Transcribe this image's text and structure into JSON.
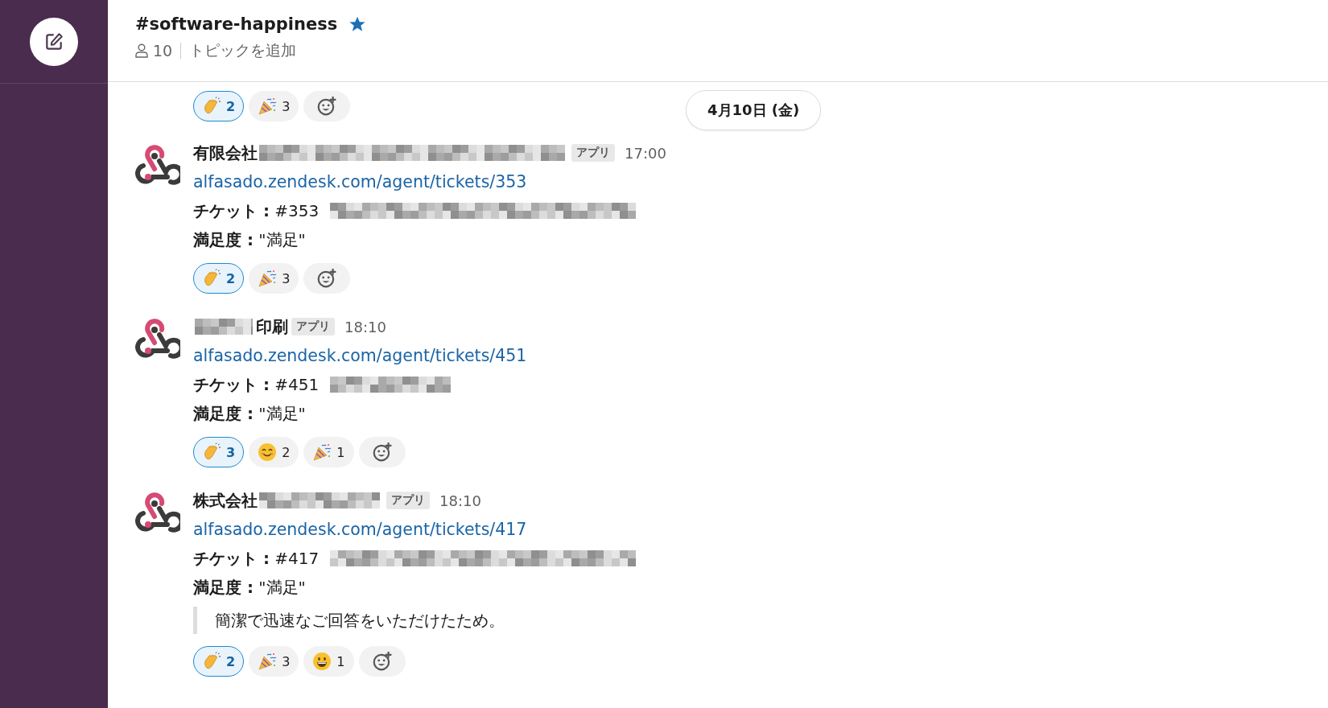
{
  "channel": {
    "name": "#software-happiness",
    "starred": true,
    "members": "10",
    "topic": "トピックを追加"
  },
  "top_reactions": [
    {
      "kind": "clap",
      "count": "2",
      "selected": true
    },
    {
      "kind": "party",
      "count": "3",
      "selected": false
    }
  ],
  "date_divider": "4月10日 (金)",
  "messages": [
    {
      "name": [
        {
          "kind": "text",
          "text": "有限会社"
        },
        {
          "kind": "longblur"
        }
      ],
      "badge": "アプリ",
      "time": "17:00",
      "link": "alfasado.zendesk.com/agent/tickets/353",
      "ticket_label": "チケット :",
      "ticket_number": "#353",
      "ticket_subject": [
        {
          "kind": "longblur"
        }
      ],
      "satisfaction_label": "満足度 :",
      "satisfaction_value": "\"満足\"",
      "reactions": [
        {
          "kind": "clap",
          "count": "2",
          "selected": true
        },
        {
          "kind": "party",
          "count": "3",
          "selected": false
        }
      ]
    },
    {
      "name": [
        {
          "kind": "shortblur"
        },
        {
          "kind": "text",
          "text": "印刷"
        }
      ],
      "badge": "アプリ",
      "time": "18:10",
      "link": "alfasado.zendesk.com/agent/tickets/451",
      "ticket_label": "チケット :",
      "ticket_number": "#451",
      "ticket_subject": [
        {
          "kind": "midblur"
        }
      ],
      "satisfaction_label": "満足度 :",
      "satisfaction_value": "\"満足\"",
      "reactions": [
        {
          "kind": "clap",
          "count": "3",
          "selected": true
        },
        {
          "kind": "smile",
          "count": "2",
          "selected": false
        },
        {
          "kind": "party",
          "count": "1",
          "selected": false
        }
      ]
    },
    {
      "name": [
        {
          "kind": "text",
          "text": "株式会社"
        },
        {
          "kind": "midblur"
        }
      ],
      "badge": "アプリ",
      "time": "18:10",
      "link": "alfasado.zendesk.com/agent/tickets/417",
      "ticket_label": "チケット :",
      "ticket_number": "#417",
      "ticket_subject": [
        {
          "kind": "longblur"
        }
      ],
      "satisfaction_label": "満足度 :",
      "satisfaction_value": "\"満足\"",
      "quote": "簡潔で迅速なご回答をいただけたため。",
      "reactions": [
        {
          "kind": "clap",
          "count": "2",
          "selected": true
        },
        {
          "kind": "party",
          "count": "3",
          "selected": false
        },
        {
          "kind": "grin",
          "count": "1",
          "selected": false
        }
      ]
    }
  ]
}
